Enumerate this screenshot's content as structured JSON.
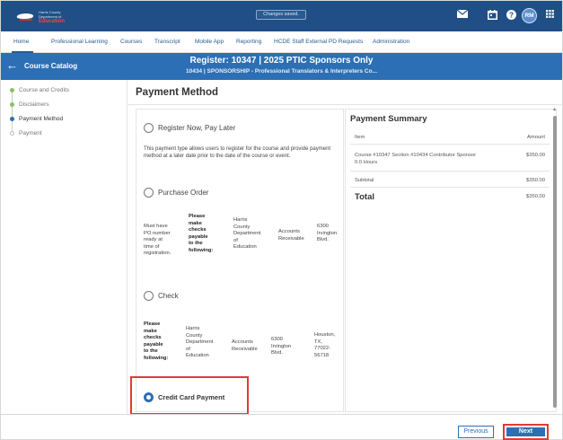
{
  "logo": {
    "line1": "Harris County",
    "line2": "Department of",
    "line3": "Education"
  },
  "toast": "Changes saved.",
  "top_icons": {
    "mail": "mail-icon",
    "calendar": "calendar-icon",
    "help": "help-icon",
    "apps": "apps-grid-icon"
  },
  "user": {
    "initials": "RM"
  },
  "nav": [
    "Home",
    "Professional Learning",
    "Courses",
    "Transcript",
    "Mobile App",
    "Reporting",
    "HCDE Staff External PD Requests",
    "Administration"
  ],
  "subheader": {
    "back_label": "Course Catalog",
    "title": "Register: 10347 | 2025 PTIC Sponsors Only",
    "subtitle": "10434 | SPONSORSHIP - Professional Translators & Interpreters Co..."
  },
  "steps": [
    {
      "label": "Course and Credits",
      "state": "done"
    },
    {
      "label": "Disclaimers",
      "state": "done"
    },
    {
      "label": "Payment Method",
      "state": "current"
    },
    {
      "label": "Payment",
      "state": "todo"
    }
  ],
  "page_title": "Payment Method",
  "methods": {
    "register_later": {
      "label": "Register Now, Pay Later",
      "desc": "This payment type allows users to register for the course and provide payment method at a later date prior to the date of the course or event."
    },
    "purchase_order": {
      "label": "Purchase Order",
      "c1": [
        "Must have",
        "PO number",
        "ready at",
        "time of",
        "registration."
      ],
      "c2": [
        "Please",
        "make",
        "checks",
        "payable",
        "to the",
        "following:"
      ],
      "c3": [
        "Harris",
        "County",
        "Department",
        "of",
        "Education"
      ],
      "c4": [
        "Accounts",
        "Receivable"
      ],
      "c5": [
        "6300",
        "Irvington",
        "Blvd."
      ]
    },
    "check": {
      "label": "Check",
      "c1": [
        "Please",
        "make",
        "checks",
        "payable",
        "to the",
        "following:"
      ],
      "c2": [
        "Harris",
        "County",
        "Department",
        "of",
        "Education"
      ],
      "c3": [
        "Accounts",
        "Receivable"
      ],
      "c4": [
        "6300",
        "Irvington",
        "Blvd."
      ],
      "c5": [
        "Houston,",
        "TX,",
        "77022-",
        "56718"
      ]
    },
    "credit_card": {
      "label": "Credit Card Payment",
      "selected": true
    }
  },
  "summary": {
    "title": "Payment Summary",
    "col_item": "Item",
    "col_amount": "Amount",
    "line_item": "Course #10347 Section #10434 Contributor Sponsor",
    "line_hours": "0.0 Hours",
    "line_amount": "$350.00",
    "subtotal_label": "Subtotal",
    "subtotal": "$350.00",
    "total_label": "Total",
    "total": "$350.00"
  },
  "footer": {
    "previous": "Previous",
    "next": "Next"
  },
  "colors": {
    "brand": "#1f4f86",
    "accent": "#2c6fb4",
    "highlight": "#e53935",
    "done": "#8bbf6b"
  }
}
